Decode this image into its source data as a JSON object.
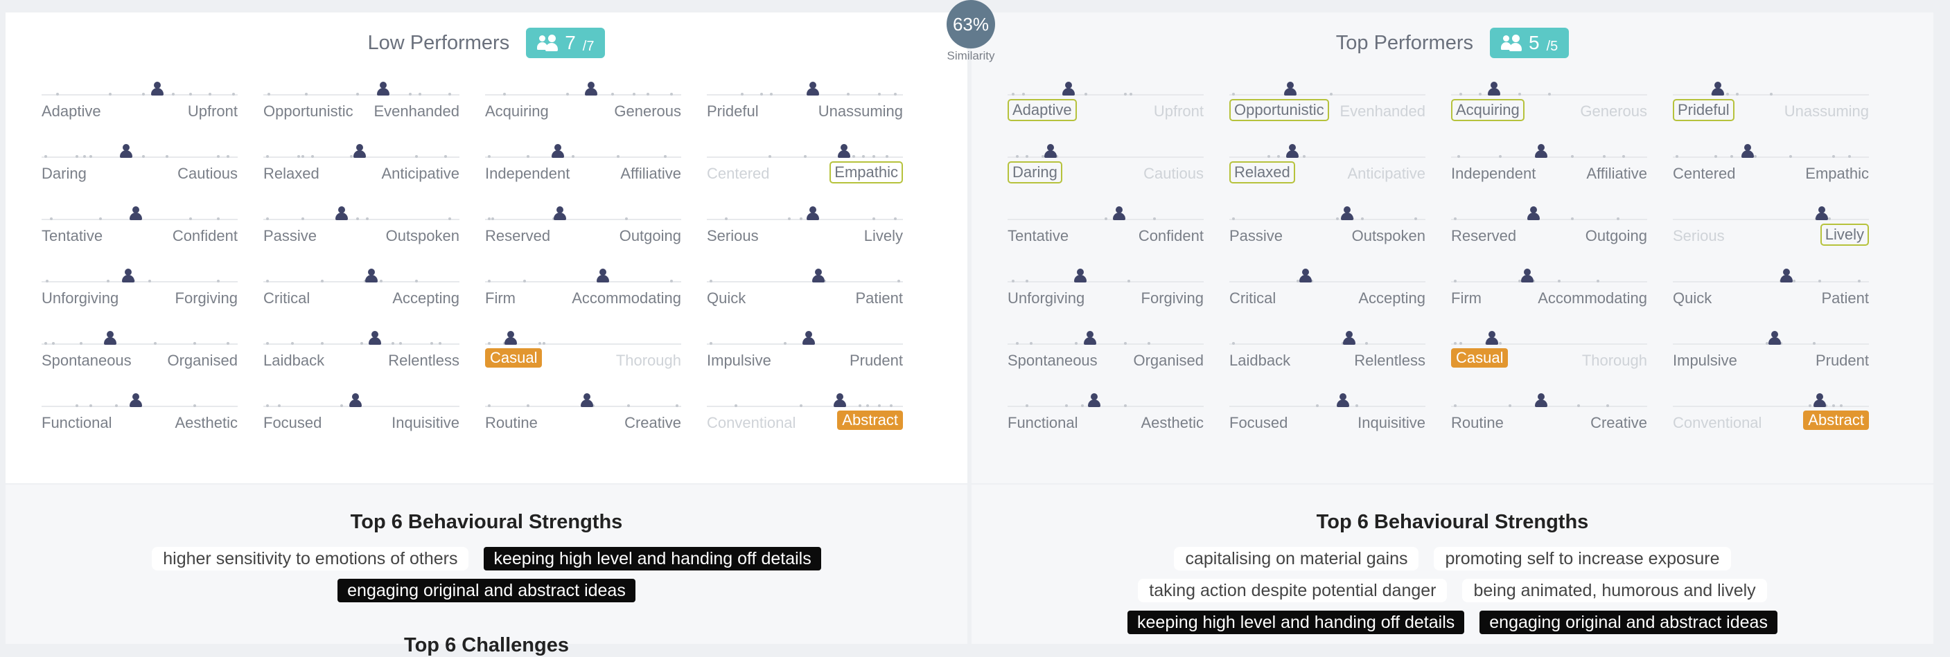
{
  "similarity": {
    "value": "63%",
    "label": "Similarity"
  },
  "left": {
    "title": "Low Performers",
    "count": "7",
    "count_den": "/7",
    "rows": [
      [
        {
          "l": "Adaptive",
          "r": "Upfront",
          "v": 0.59,
          "ticks": [
            0.08,
            0.35,
            0.52,
            0.67,
            0.76,
            0.86,
            0.98
          ],
          "ls": "",
          "rs": ""
        },
        {
          "l": "Opportunistic",
          "r": "Evenhanded",
          "v": 0.61,
          "ticks": [
            0.03,
            0.22,
            0.48,
            0.75,
            0.8,
            0.95
          ],
          "ls": "",
          "rs": ""
        },
        {
          "l": "Acquiring",
          "r": "Generous",
          "v": 0.54,
          "ticks": [
            0.1,
            0.42,
            0.65,
            0.76,
            0.83,
            0.95
          ],
          "ls": "",
          "rs": ""
        },
        {
          "l": "Prideful",
          "r": "Unassuming",
          "v": 0.54,
          "ticks": [
            0.18,
            0.28,
            0.33,
            0.72,
            0.88,
            0.96
          ],
          "ls": "",
          "rs": ""
        }
      ],
      [
        {
          "l": "Daring",
          "r": "Cautious",
          "v": 0.43,
          "ticks": [
            0.02,
            0.18,
            0.22,
            0.25,
            0.52,
            0.64,
            0.9,
            0.95
          ],
          "ls": "",
          "rs": ""
        },
        {
          "l": "Relaxed",
          "r": "Anticipative",
          "v": 0.49,
          "ticks": [
            0.02,
            0.18,
            0.2,
            0.25,
            0.45,
            0.78,
            0.93
          ],
          "ls": "",
          "rs": ""
        },
        {
          "l": "Independent",
          "r": "Affiliative",
          "v": 0.37,
          "ticks": [
            0.02,
            0.22,
            0.45,
            0.68,
            0.92
          ],
          "ls": "",
          "rs": ""
        },
        {
          "l": "Centered",
          "r": "Empathic",
          "v": 0.7,
          "ticks": [
            0.32,
            0.5,
            0.75,
            0.8,
            0.85,
            0.92
          ],
          "ls": "faded",
          "rs": "outlined"
        }
      ],
      [
        {
          "l": "Tentative",
          "r": "Confident",
          "v": 0.48,
          "ticks": [
            0.05,
            0.3,
            0.5,
            0.76,
            0.9
          ],
          "ls": "",
          "rs": ""
        },
        {
          "l": "Passive",
          "r": "Outspoken",
          "v": 0.4,
          "ticks": [
            0.02,
            0.2,
            0.4,
            0.48,
            0.53,
            0.95
          ],
          "ls": "",
          "rs": ""
        },
        {
          "l": "Reserved",
          "r": "Outgoing",
          "v": 0.38,
          "ticks": [
            0.02,
            0.04,
            0.35,
            0.72
          ],
          "ls": "",
          "rs": ""
        },
        {
          "l": "Serious",
          "r": "Lively",
          "v": 0.54,
          "ticks": [
            0.1,
            0.42,
            0.48,
            0.85,
            0.96
          ],
          "ls": "",
          "rs": ""
        }
      ],
      [
        {
          "l": "Unforgiving",
          "r": "Forgiving",
          "v": 0.44,
          "ticks": [
            0.03,
            0.34,
            0.47,
            0.55,
            0.9
          ],
          "ls": "",
          "rs": ""
        },
        {
          "l": "Critical",
          "r": "Accepting",
          "v": 0.55,
          "ticks": [
            0.02,
            0.3,
            0.52,
            0.6,
            0.78
          ],
          "ls": "",
          "rs": ""
        },
        {
          "l": "Firm",
          "r": "Accommodating",
          "v": 0.6,
          "ticks": [
            0.02,
            0.2,
            0.6,
            0.95
          ],
          "ls": "",
          "rs": ""
        },
        {
          "l": "Quick",
          "r": "Patient",
          "v": 0.57,
          "ticks": [
            0.02,
            0.55,
            0.6,
            0.98
          ],
          "ls": "",
          "rs": ""
        }
      ],
      [
        {
          "l": "Spontaneous",
          "r": "Organised",
          "v": 0.35,
          "ticks": [
            0.02,
            0.06,
            0.2,
            0.35,
            0.58,
            0.78,
            0.95
          ],
          "ls": "",
          "rs": ""
        },
        {
          "l": "Laidback",
          "r": "Relentless",
          "v": 0.57,
          "ticks": [
            0.02,
            0.15,
            0.3,
            0.5,
            0.66,
            0.7,
            0.86,
            0.9
          ],
          "ls": "",
          "rs": ""
        },
        {
          "l": "Casual",
          "r": "Thorough",
          "v": 0.13,
          "ticks": [
            0.02,
            0.1,
            0.28,
            0.3
          ],
          "ls": "filled",
          "rs": "faded"
        },
        {
          "l": "Impulsive",
          "r": "Prudent",
          "v": 0.52,
          "ticks": [
            0.02,
            0.4,
            0.52
          ],
          "ls": "",
          "rs": ""
        }
      ],
      [
        {
          "l": "Functional",
          "r": "Aesthetic",
          "v": 0.48,
          "ticks": [
            0.18,
            0.25,
            0.38,
            0.5,
            0.78
          ],
          "ls": "",
          "rs": ""
        },
        {
          "l": "Focused",
          "r": "Inquisitive",
          "v": 0.47,
          "ticks": [
            0.02,
            0.08,
            0.4,
            0.48
          ],
          "ls": "",
          "rs": ""
        },
        {
          "l": "Routine",
          "r": "Creative",
          "v": 0.52,
          "ticks": [
            0.02,
            0.22,
            0.55,
            0.73,
            0.98
          ],
          "ls": "",
          "rs": ""
        },
        {
          "l": "Conventional",
          "r": "Abstract",
          "v": 0.68,
          "ticks": [
            0.15,
            0.48,
            0.7,
            0.78,
            0.82,
            0.88,
            0.94
          ],
          "ls": "faded",
          "rs": "filled"
        }
      ]
    ]
  },
  "right": {
    "title": "Top Performers",
    "count": "5",
    "count_den": "/5",
    "rows": [
      [
        {
          "l": "Adaptive",
          "r": "Upfront",
          "v": 0.31,
          "ticks": [
            0.03,
            0.08,
            0.3,
            0.4,
            0.6,
            0.63
          ],
          "ls": "outlined",
          "rs": "faded"
        },
        {
          "l": "Opportunistic",
          "r": "Evenhanded",
          "v": 0.31,
          "ticks": [
            0.02,
            0.3,
            0.52
          ],
          "ls": "outlined",
          "rs": "faded"
        },
        {
          "l": "Acquiring",
          "r": "Generous",
          "v": 0.22,
          "ticks": [
            0.05,
            0.15,
            0.35,
            0.5
          ],
          "ls": "outlined",
          "rs": "faded"
        },
        {
          "l": "Prideful",
          "r": "Unassuming",
          "v": 0.23,
          "ticks": [
            0.2,
            0.28,
            0.33,
            0.5
          ],
          "ls": "outlined",
          "rs": "faded"
        }
      ],
      [
        {
          "l": "Daring",
          "r": "Cautious",
          "v": 0.22,
          "ticks": [
            0.05,
            0.1,
            0.18,
            0.25
          ],
          "ls": "outlined",
          "rs": "faded"
        },
        {
          "l": "Relaxed",
          "r": "Anticipative",
          "v": 0.32,
          "ticks": [
            0.2,
            0.25,
            0.38
          ],
          "ls": "outlined",
          "rs": "faded"
        },
        {
          "l": "Independent",
          "r": "Affiliative",
          "v": 0.46,
          "ticks": [
            0.04,
            0.25,
            0.48,
            0.62,
            0.78,
            0.88
          ],
          "ls": "",
          "rs": ""
        },
        {
          "l": "Centered",
          "r": "Empathic",
          "v": 0.38,
          "ticks": [
            0.02,
            0.22,
            0.3,
            0.38,
            0.42,
            0.6,
            0.82,
            0.9
          ],
          "ls": "",
          "rs": ""
        }
      ],
      [
        {
          "l": "Tentative",
          "r": "Confident",
          "v": 0.57,
          "ticks": [
            0.5,
            0.58,
            0.75
          ],
          "ls": "",
          "rs": ""
        },
        {
          "l": "Passive",
          "r": "Outspoken",
          "v": 0.6,
          "ticks": [
            0.02,
            0.55,
            0.63,
            0.68,
            0.95
          ],
          "ls": "",
          "rs": ""
        },
        {
          "l": "Reserved",
          "r": "Outgoing",
          "v": 0.42,
          "ticks": [
            0.02,
            0.4,
            0.62,
            0.85
          ],
          "ls": "",
          "rs": ""
        },
        {
          "l": "Serious",
          "r": "Lively",
          "v": 0.76,
          "ticks": [
            0.73,
            0.8
          ],
          "ls": "faded",
          "rs": "outlined"
        }
      ],
      [
        {
          "l": "Unforgiving",
          "r": "Forgiving",
          "v": 0.37,
          "ticks": [
            0.03,
            0.1,
            0.35,
            0.62
          ],
          "ls": "",
          "rs": ""
        },
        {
          "l": "Critical",
          "r": "Accepting",
          "v": 0.39,
          "ticks": [
            0.35,
            0.42
          ],
          "ls": "",
          "rs": ""
        },
        {
          "l": "Firm",
          "r": "Accommodating",
          "v": 0.39,
          "ticks": [
            0.02,
            0.35,
            0.42,
            0.55,
            0.75
          ],
          "ls": "",
          "rs": ""
        },
        {
          "l": "Quick",
          "r": "Patient",
          "v": 0.58,
          "ticks": [
            0.55,
            0.62,
            0.75,
            0.95
          ],
          "ls": "",
          "rs": ""
        }
      ],
      [
        {
          "l": "Spontaneous",
          "r": "Organised",
          "v": 0.42,
          "ticks": [
            0.05,
            0.12,
            0.35,
            0.42,
            0.6,
            0.72
          ],
          "ls": "",
          "rs": ""
        },
        {
          "l": "Laidback",
          "r": "Relentless",
          "v": 0.61,
          "ticks": [
            0.02,
            0.58,
            0.7
          ],
          "ls": "",
          "rs": ""
        },
        {
          "l": "Casual",
          "r": "Thorough",
          "v": 0.21,
          "ticks": [
            0.02,
            0.05,
            0.18,
            0.25
          ],
          "ls": "filled",
          "rs": "faded"
        },
        {
          "l": "Impulsive",
          "r": "Prudent",
          "v": 0.52,
          "ticks": [
            0.48,
            0.55,
            0.72
          ],
          "ls": "",
          "rs": ""
        }
      ],
      [
        {
          "l": "Functional",
          "r": "Aesthetic",
          "v": 0.44,
          "ticks": [
            0.1,
            0.3,
            0.38,
            0.44,
            0.6
          ],
          "ls": "",
          "rs": ""
        },
        {
          "l": "Focused",
          "r": "Inquisitive",
          "v": 0.58,
          "ticks": [
            0.45,
            0.58,
            0.65
          ],
          "ls": "",
          "rs": ""
        },
        {
          "l": "Routine",
          "r": "Creative",
          "v": 0.46,
          "ticks": [
            0.02,
            0.3,
            0.46,
            0.65,
            0.8
          ],
          "ls": "",
          "rs": ""
        },
        {
          "l": "Conventional",
          "r": "Abstract",
          "v": 0.75,
          "ticks": [
            0.7,
            0.78,
            0.82,
            0.86
          ],
          "ls": "faded",
          "rs": "filled"
        }
      ]
    ]
  },
  "left_strengths": {
    "title": "Top 6 Behavioural Strengths",
    "rows": [
      [
        {
          "text": "higher sensitivity to emotions of others",
          "dark": false
        },
        {
          "text": "keeping high level and handing off details",
          "dark": true
        }
      ],
      [
        {
          "text": "engaging original and abstract ideas",
          "dark": true
        }
      ]
    ],
    "next_title": "Top 6 Challenges"
  },
  "right_strengths": {
    "title": "Top 6 Behavioural Strengths",
    "rows": [
      [
        {
          "text": "capitalising on material gains",
          "dark": false
        },
        {
          "text": "promoting self to increase exposure",
          "dark": false
        }
      ],
      [
        {
          "text": "taking action despite potential danger",
          "dark": false
        },
        {
          "text": "being animated, humorous and lively",
          "dark": false
        }
      ],
      [
        {
          "text": "keeping high level and handing off details",
          "dark": true
        },
        {
          "text": "engaging original and abstract ideas",
          "dark": true
        }
      ]
    ]
  }
}
